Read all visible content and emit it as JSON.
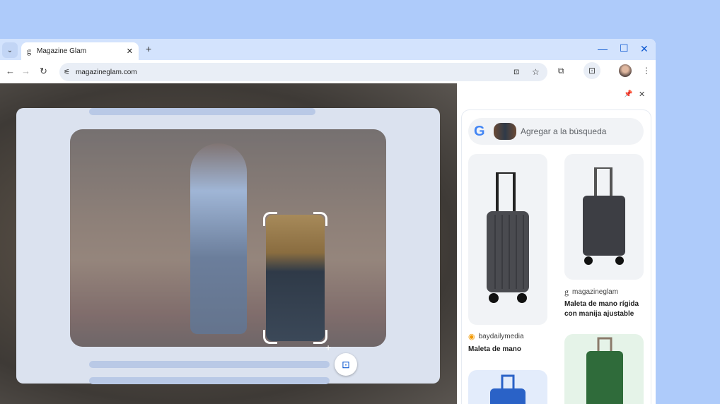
{
  "browser": {
    "tab_title": "Magazine Glam",
    "url": "magazineglam.com"
  },
  "side_panel": {
    "search_placeholder": "Agregar a la búsqueda",
    "results": [
      {
        "source": "baydailymedia",
        "title": "Maleta de mano",
        "color": "#4a4b50"
      },
      {
        "source": "magazineglam",
        "title": "Maleta de mano rígida con manija ajustable",
        "color": "#3d3e44"
      },
      {
        "source": "",
        "title": "",
        "color": "#2a62c7"
      },
      {
        "source": "",
        "title": "",
        "color": "#2f6b3a"
      }
    ]
  },
  "colors": {
    "accent": "#0b57d0",
    "tabstrip": "#d3e3fd",
    "background": "#aecbfa"
  }
}
